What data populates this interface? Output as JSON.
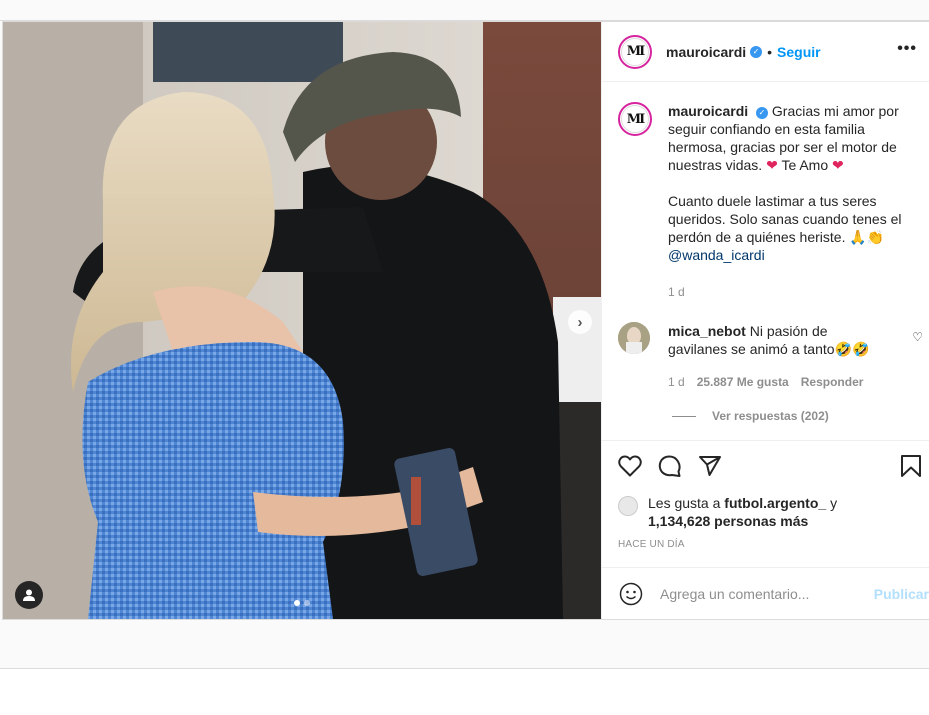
{
  "post": {
    "username": "mauroicardi",
    "avatar_text": "MI",
    "follow_label": "Seguir",
    "separator": "•",
    "more_label": "•••",
    "caption": {
      "line1": "Gracias mi amor por seguir confiando en esta familia hermosa, gracias por ser el motor de nuestras vidas.",
      "heart": "❤",
      "te_amo": "Te Amo",
      "line2": "Cuanto duele lastimar a tus seres queridos. Solo sanas cuando tenes el perdón de a quiénes heriste.",
      "emojis": "🙏👏",
      "mention": "@wanda_icardi"
    },
    "caption_time": "1 d",
    "comment": {
      "username": "mica_nebot",
      "text": "Ni pasión de gavilanes se animó a tanto",
      "emojis": "🤣🤣",
      "time": "1 d",
      "likes": "25.887 Me gusta",
      "reply_label": "Responder",
      "heart": "♡"
    },
    "view_replies": "Ver respuestas (202)",
    "likes_prefix": "Les gusta a",
    "likes_user": "futbol.argento_",
    "likes_conj": "y",
    "likes_count": "1,134,628 personas más",
    "time_ago": "HACE UN DÍA",
    "add_comment_placeholder": "Agrega un comentario...",
    "publish_label": "Publicar",
    "carousel_index": 1,
    "carousel_total": 2
  },
  "colors": {
    "accent": "#0095f6",
    "publish_disabled": "#b2dffc",
    "heart": "#e0245e",
    "muted": "#8e8e8e"
  }
}
